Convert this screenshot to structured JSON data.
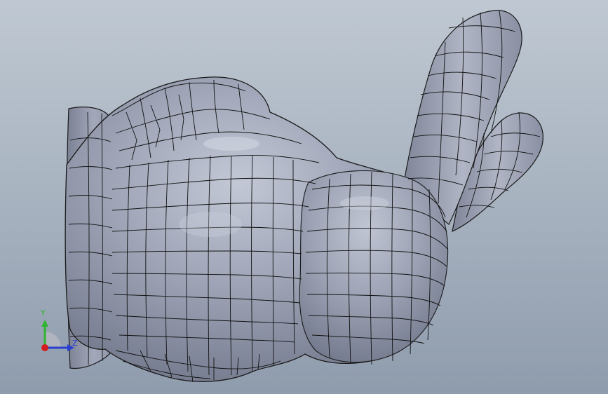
{
  "viewport": {
    "background_top": "#bfc8d2",
    "background_bottom": "#8f9cad",
    "model_color": "#8d93a6",
    "mesh_edge_color": "#111111"
  },
  "triad": {
    "y_label": "Y",
    "z_label": "Z",
    "y_color": "#2fb52f",
    "z_color": "#2a3fd0",
    "x_color": "#d11e1e"
  }
}
